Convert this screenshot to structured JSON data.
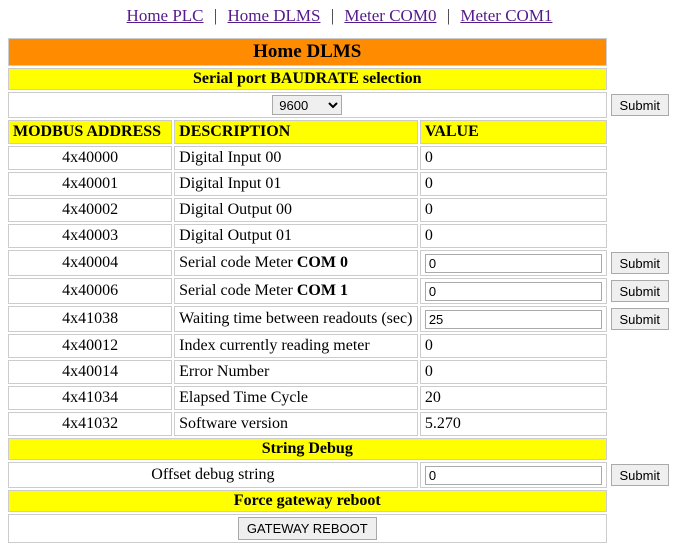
{
  "nav": {
    "links": [
      "Home PLC",
      "Home DLMS",
      "Meter COM0",
      "Meter COM1"
    ],
    "separator": "|"
  },
  "title": "Home DLMS",
  "baudrate": {
    "heading": "Serial port BAUDRATE selection",
    "selected": "9600",
    "submit_label": "Submit"
  },
  "columns": {
    "address": "MODBUS ADDRESS",
    "description": "DESCRIPTION",
    "value": "VALUE"
  },
  "rows": [
    {
      "addr": "4x40000",
      "desc": "Digital Input 00",
      "desc_bold": "",
      "value": "0",
      "editable": false,
      "submit": false
    },
    {
      "addr": "4x40001",
      "desc": "Digital Input 01",
      "desc_bold": "",
      "value": "0",
      "editable": false,
      "submit": false
    },
    {
      "addr": "4x40002",
      "desc": "Digital Output 00",
      "desc_bold": "",
      "value": "0",
      "editable": false,
      "submit": false
    },
    {
      "addr": "4x40003",
      "desc": "Digital Output 01",
      "desc_bold": "",
      "value": "0",
      "editable": false,
      "submit": false
    },
    {
      "addr": "4x40004",
      "desc": "Serial code Meter ",
      "desc_bold": "COM 0",
      "value": "0",
      "editable": true,
      "submit": true
    },
    {
      "addr": "4x40006",
      "desc": "Serial code Meter ",
      "desc_bold": "COM 1",
      "value": "0",
      "editable": true,
      "submit": true
    },
    {
      "addr": "4x41038",
      "desc": "Waiting time between readouts (sec)",
      "desc_bold": "",
      "value": "25",
      "editable": true,
      "submit": true
    },
    {
      "addr": "4x40012",
      "desc": "Index currently reading meter",
      "desc_bold": "",
      "value": "0",
      "editable": false,
      "submit": false
    },
    {
      "addr": "4x40014",
      "desc": "Error Number",
      "desc_bold": "",
      "value": "0",
      "editable": false,
      "submit": false
    },
    {
      "addr": "4x41034",
      "desc": "Elapsed Time Cycle",
      "desc_bold": "",
      "value": "20",
      "editable": false,
      "submit": false
    },
    {
      "addr": "4x41032",
      "desc": "Software version",
      "desc_bold": "",
      "value": "5.270",
      "editable": false,
      "submit": false
    }
  ],
  "submit_label": "Submit",
  "string_debug": {
    "heading": "String Debug",
    "label": "Offset debug string",
    "value": "0",
    "submit_label": "Submit"
  },
  "reboot": {
    "heading": "Force gateway reboot",
    "button": "GATEWAY REBOOT"
  }
}
